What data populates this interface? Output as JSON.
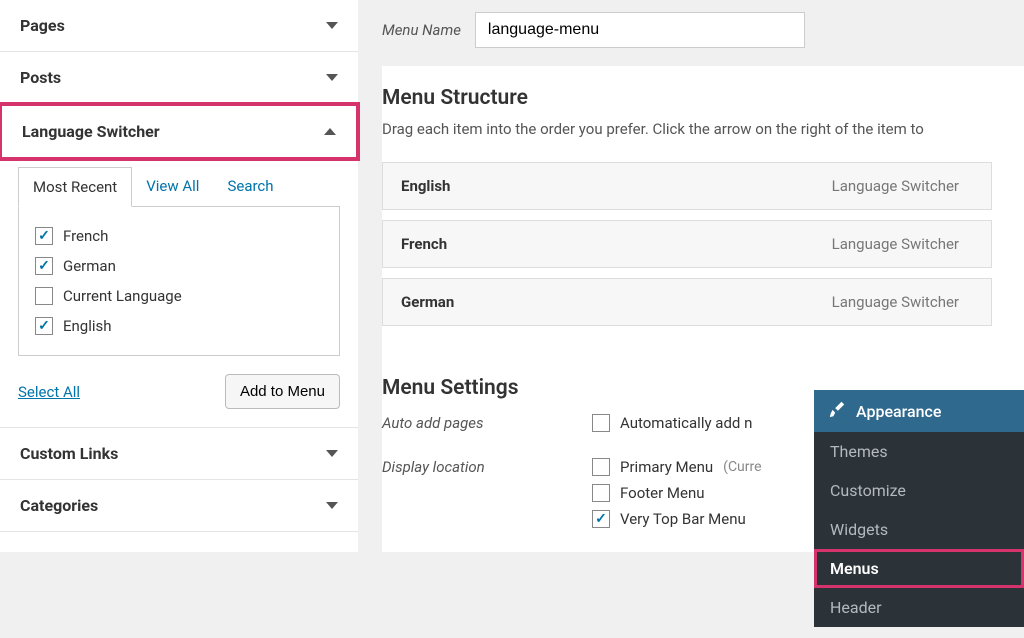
{
  "sidebar": {
    "items": [
      {
        "label": "Pages",
        "expanded": false
      },
      {
        "label": "Posts",
        "expanded": false
      },
      {
        "label": "Language Switcher",
        "expanded": true,
        "highlighted": true,
        "tabs": [
          {
            "label": "Most Recent",
            "active": true
          },
          {
            "label": "View All",
            "active": false
          },
          {
            "label": "Search",
            "active": false
          }
        ],
        "options": [
          {
            "label": "French",
            "checked": true
          },
          {
            "label": "German",
            "checked": true
          },
          {
            "label": "Current Language",
            "checked": false
          },
          {
            "label": "English",
            "checked": true
          }
        ],
        "select_all": "Select All",
        "add_button": "Add to Menu"
      },
      {
        "label": "Custom Links",
        "expanded": false
      },
      {
        "label": "Categories",
        "expanded": false
      }
    ]
  },
  "main": {
    "menu_name_label": "Menu Name",
    "menu_name_value": "language-menu",
    "structure": {
      "title": "Menu Structure",
      "hint": "Drag each item into the order you prefer. Click the arrow on the right of the item to",
      "items": [
        {
          "label": "English",
          "type": "Language Switcher"
        },
        {
          "label": "French",
          "type": "Language Switcher"
        },
        {
          "label": "German",
          "type": "Language Switcher"
        }
      ]
    },
    "settings": {
      "title": "Menu Settings",
      "auto_add_label": "Auto add pages",
      "auto_add_option": "Automatically add n",
      "display_location_label": "Display location",
      "locations": [
        {
          "label": "Primary Menu",
          "suffix": "(Curre",
          "checked": false
        },
        {
          "label": "Footer Menu",
          "suffix": "",
          "checked": false
        },
        {
          "label": "Very Top Bar Menu",
          "suffix": "",
          "checked": true
        }
      ]
    }
  },
  "wp_panel": {
    "head": "Appearance",
    "items": [
      {
        "label": "Themes",
        "highlight": false
      },
      {
        "label": "Customize",
        "highlight": false
      },
      {
        "label": "Widgets",
        "highlight": false
      },
      {
        "label": "Menus",
        "highlight": true
      },
      {
        "label": "Header",
        "highlight": false
      }
    ]
  }
}
